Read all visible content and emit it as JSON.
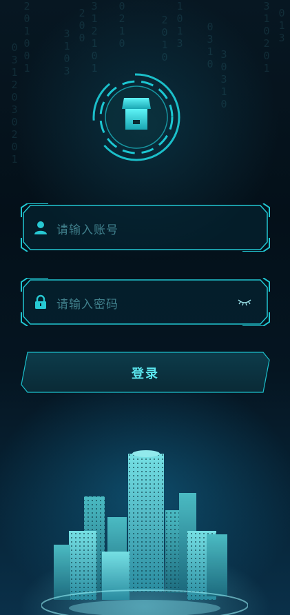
{
  "login_form": {
    "username_placeholder": "请输入账号",
    "password_placeholder": "请输入密码",
    "login_label": "登录"
  },
  "background": {
    "digit_columns": [
      "0312030201",
      "201001",
      "3103",
      "200",
      "312101",
      "0210",
      "2010",
      "1013",
      "0310",
      "30310",
      "310201",
      "013"
    ]
  },
  "colors": {
    "accent": "#22d3dd",
    "placeholder": "#3f7e8a",
    "background": "#041019"
  },
  "icons": {
    "user": "user-icon",
    "lock": "lock-icon",
    "eye": "eye-closed-icon",
    "logo": "store-icon"
  }
}
